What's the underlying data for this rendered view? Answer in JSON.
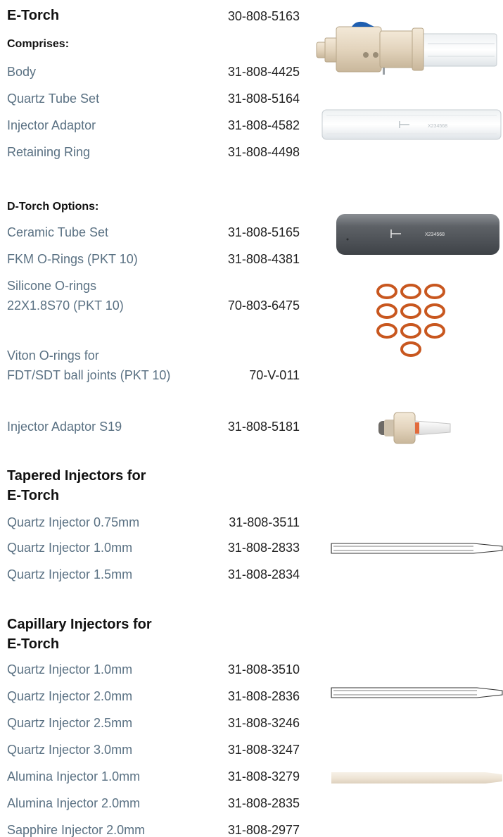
{
  "etorch": {
    "title": "E-Torch",
    "part": "30-808-5163",
    "comprises": "Comprises:"
  },
  "comprises_items": [
    {
      "name": "Body",
      "part": "31-808-4425"
    },
    {
      "name": "Quartz Tube Set",
      "part": "31-808-5164"
    },
    {
      "name": "Injector Adaptor",
      "part": "31-808-4582"
    },
    {
      "name": "Retaining Ring",
      "part": "31-808-4498"
    }
  ],
  "dtorch": {
    "heading": "D-Torch Options:"
  },
  "dtorch_items": [
    {
      "name": "Ceramic Tube Set",
      "part": "31-808-5165"
    },
    {
      "name": "FKM O-Rings (PKT 10)",
      "part": "31-808-4381"
    },
    {
      "name_line1": "Silicone O-rings",
      "name_line2": "22X1.8S70 (PKT 10)",
      "part": "70-803-6475"
    },
    {
      "name_line1": "Viton O-rings for",
      "name_line2": "FDT/SDT ball joints (PKT 10)",
      "part": "70-V-011"
    },
    {
      "name": "Injector Adaptor S19",
      "part": "31-808-5181"
    }
  ],
  "tapered": {
    "heading_line1": "Tapered Injectors for",
    "heading_line2": "E-Torch",
    "items": [
      {
        "name": "Quartz Injector 0.75mm",
        "part": "31-808-3511"
      },
      {
        "name": "Quartz Injector 1.0mm",
        "part": "31-808-2833"
      },
      {
        "name": "Quartz Injector 1.5mm",
        "part": "31-808-2834"
      }
    ]
  },
  "capillary": {
    "heading_line1": "Capillary Injectors for",
    "heading_line2": "E-Torch",
    "items": [
      {
        "name": "Quartz Injector 1.0mm",
        "part": "31-808-3510"
      },
      {
        "name": "Quartz Injector 2.0mm",
        "part": "31-808-2836"
      },
      {
        "name": "Quartz Injector 2.5mm",
        "part": "31-808-3246"
      },
      {
        "name": "Quartz Injector 3.0mm",
        "part": "31-808-3247"
      },
      {
        "name": "Alumina Injector 1.0mm",
        "part": "31-808-3279"
      },
      {
        "name": "Alumina Injector 2.0mm",
        "part": "31-808-2835"
      },
      {
        "name": "Sapphire Injector 2.0mm",
        "part": "31-808-2977"
      }
    ]
  },
  "ceramic_tube_marking": "X234568",
  "quartz_tube_marking": "X234568",
  "colors": {
    "label_text": "#5a7183",
    "part_text": "#222222",
    "heading_text": "#111111",
    "o_ring": "#c8571f",
    "ceramic_tube": "#55595e",
    "torch_body": "#e3d4bd",
    "accent_blue": "#1f5fb0",
    "alumina": "#efe5d6"
  },
  "icons": [
    "torch-body-image",
    "quartz-tube-image",
    "ceramic-tube-image",
    "o-rings-image",
    "injector-adaptor-image",
    "tapered-injector-image",
    "capillary-injector-image",
    "alumina-injector-image"
  ]
}
